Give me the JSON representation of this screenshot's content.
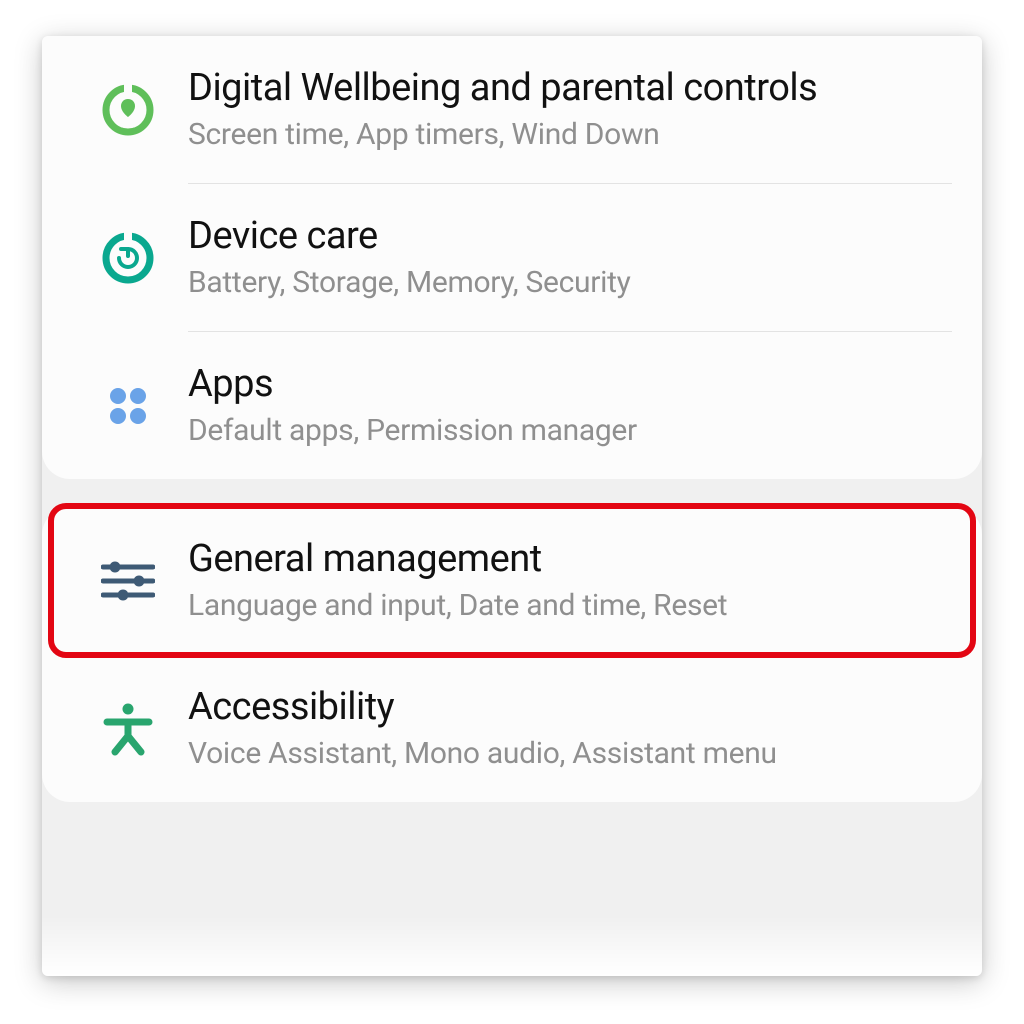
{
  "groups": [
    {
      "items": [
        {
          "id": "digital-wellbeing",
          "title": "Digital Wellbeing and parental controls",
          "subtitle": "Screen time, App timers, Wind Down",
          "icon": "heart-circle",
          "highlighted": false
        },
        {
          "id": "device-care",
          "title": "Device care",
          "subtitle": "Battery, Storage, Memory, Security",
          "icon": "refresh-circle",
          "highlighted": false
        },
        {
          "id": "apps",
          "title": "Apps",
          "subtitle": "Default apps, Permission manager",
          "icon": "four-dots",
          "highlighted": false
        }
      ]
    },
    {
      "items": [
        {
          "id": "general-management",
          "title": "General management",
          "subtitle": "Language and input, Date and time, Reset",
          "icon": "sliders",
          "highlighted": true
        },
        {
          "id": "accessibility",
          "title": "Accessibility",
          "subtitle": "Voice Assistant, Mono audio, Assistant menu",
          "icon": "person",
          "highlighted": false
        }
      ]
    }
  ],
  "colors": {
    "green": "#5fbf5a",
    "teal": "#0aa88f",
    "blue": "#6aa3e8",
    "slate": "#3e5a75",
    "mint": "#29a56e",
    "highlight": "#e30613"
  }
}
